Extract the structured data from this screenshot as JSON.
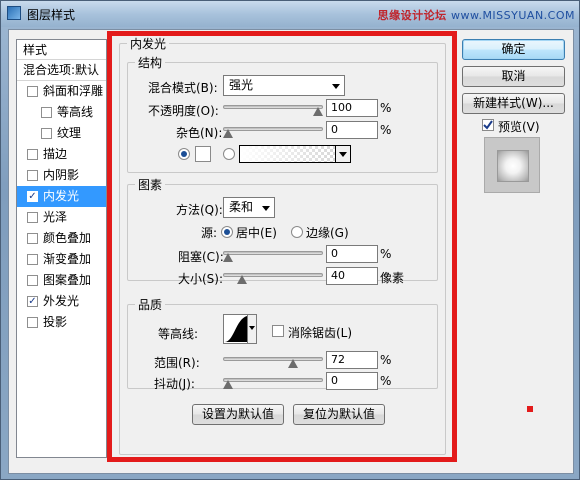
{
  "window": {
    "title": "图层样式"
  },
  "watermark": {
    "brand": "思缘设计论坛",
    "url": "www.MISSYUAN.COM"
  },
  "styles_panel": {
    "header": "样式",
    "blend_options": "混合选项:默认",
    "items": [
      {
        "label": "斜面和浮雕",
        "checked": false,
        "sub": false,
        "active": false
      },
      {
        "label": "等高线",
        "checked": false,
        "sub": true,
        "active": false
      },
      {
        "label": "纹理",
        "checked": false,
        "sub": true,
        "active": false
      },
      {
        "label": "描边",
        "checked": false,
        "sub": false,
        "active": false
      },
      {
        "label": "内阴影",
        "checked": false,
        "sub": false,
        "active": false
      },
      {
        "label": "内发光",
        "checked": true,
        "sub": false,
        "active": true
      },
      {
        "label": "光泽",
        "checked": false,
        "sub": false,
        "active": false
      },
      {
        "label": "颜色叠加",
        "checked": false,
        "sub": false,
        "active": false
      },
      {
        "label": "渐变叠加",
        "checked": false,
        "sub": false,
        "active": false
      },
      {
        "label": "图案叠加",
        "checked": false,
        "sub": false,
        "active": false
      },
      {
        "label": "外发光",
        "checked": true,
        "sub": false,
        "active": false
      },
      {
        "label": "投影",
        "checked": false,
        "sub": false,
        "active": false
      }
    ]
  },
  "inner_glow": {
    "title": "内发光",
    "structure": {
      "legend": "结构",
      "blend_mode_label": "混合模式(B):",
      "blend_mode_value": "强光",
      "opacity_label": "不透明度(O):",
      "opacity_value": "100",
      "opacity_fraction": 1.0,
      "noise_label": "杂色(N):",
      "noise_value": "0",
      "noise_fraction": 0.0,
      "percent": "%"
    },
    "elements": {
      "legend": "图素",
      "method_label": "方法(Q):",
      "method_value": "柔和",
      "source_label": "源:",
      "source_center": "居中(E)",
      "source_edge": "边缘(G)",
      "source_selected": "center",
      "choke_label": "阻塞(C):",
      "choke_value": "0",
      "choke_fraction": 0.0,
      "size_label": "大小(S):",
      "size_value": "40",
      "size_fraction": 0.16,
      "size_unit": "像素",
      "percent": "%"
    },
    "quality": {
      "legend": "品质",
      "contour_label": "等高线:",
      "antialias_label": "消除锯齿(L)",
      "antialias_checked": false,
      "range_label": "范围(R):",
      "range_value": "72",
      "range_fraction": 0.72,
      "jitter_label": "抖动(J):",
      "jitter_value": "0",
      "jitter_fraction": 0.0,
      "percent": "%"
    },
    "set_default_button": "设置为默认值",
    "reset_default_button": "复位为默认值"
  },
  "right_panel": {
    "ok_button": "确定",
    "cancel_button": "取消",
    "new_style_button": "新建样式(W)...",
    "preview_label": "预览(V)",
    "preview_checked": true
  },
  "colors": {
    "highlight": "#e31b1b",
    "selection": "#3399ff"
  }
}
